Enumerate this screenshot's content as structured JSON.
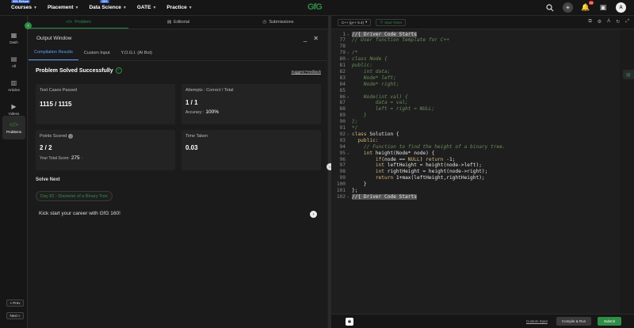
{
  "nav": {
    "items": [
      {
        "label": "Courses",
        "tag": "90% Refund"
      },
      {
        "label": "Placement",
        "tag": ""
      },
      {
        "label": "Data Science",
        "tag": "DSS"
      },
      {
        "label": "GATE",
        "tag": ""
      },
      {
        "label": "Practice",
        "tag": ""
      }
    ],
    "logo": "GfG",
    "notifications": "24",
    "avatar": "A"
  },
  "sidebar": {
    "items": [
      {
        "label": "Dash",
        "icon": "dash-icon"
      },
      {
        "label": "All",
        "icon": "all-icon"
      },
      {
        "label": "Articles",
        "icon": "articles-icon"
      },
      {
        "label": "Videos",
        "icon": "videos-icon"
      },
      {
        "label": "Problems",
        "icon": "code-icon"
      }
    ],
    "prev": "« Prev",
    "next": "Next »"
  },
  "problem_tabs": [
    {
      "label": "Problem",
      "active": true
    },
    {
      "label": "Editorial",
      "active": false
    },
    {
      "label": "Submissions",
      "active": false
    }
  ],
  "output": {
    "title": "Output Window",
    "tabs": [
      "Compilation Results",
      "Custom Input",
      "Y.O.G.I. (AI Bot)"
    ],
    "status": "Problem Solved Successfully",
    "feedback": "Suggest Feedback",
    "test_cases_label": "Test Cases Passed",
    "test_cases_value": "1115 / 1115",
    "attempts_label": "Attempts : Correct / Total",
    "attempts_value": "1 / 1",
    "accuracy_label": "Accuracy :",
    "accuracy_value": "100%",
    "points_label": "Points Scored",
    "points_value": "2 / 2",
    "total_score_label": "Your Total Score:",
    "total_score_value": "275",
    "time_label": "Time Taken",
    "time_value": "0.03",
    "solve_next": "Solve Next",
    "next_problem": "Day 82 - Diameter of a Binary Tree",
    "kick": "Kick start your career with GfG 160!"
  },
  "editor": {
    "language": "C++ (g++ 5.4)",
    "timer": "Start Timer",
    "lines": [
      {
        "n": "1",
        "html": "<span class=\"hl\">//{ Driver Code Starts</span>"
      },
      {
        "n": "77",
        "html": "<span class=\"cm\">// User function template for C++</span>"
      },
      {
        "n": "78",
        "html": ""
      },
      {
        "n": "79",
        "html": "<span class=\"cm\">/*</span>"
      },
      {
        "n": "80",
        "html": "<span class=\"cm\">class Node {</span>"
      },
      {
        "n": "81",
        "html": "<span class=\"cm\">public:</span>"
      },
      {
        "n": "82",
        "html": "<span class=\"cm\">    int data;</span>"
      },
      {
        "n": "83",
        "html": "<span class=\"cm\">    Node* left;</span>"
      },
      {
        "n": "84",
        "html": "<span class=\"cm\">    Node* right;</span>"
      },
      {
        "n": "85",
        "html": ""
      },
      {
        "n": "86",
        "html": "<span class=\"cm\">    Node(int val) {</span>"
      },
      {
        "n": "87",
        "html": "<span class=\"cm\">        data = val;</span>"
      },
      {
        "n": "88",
        "html": "<span class=\"cm\">        left = right = NULL;</span>"
      },
      {
        "n": "89",
        "html": "<span class=\"cm\">    }</span>"
      },
      {
        "n": "90",
        "html": "<span class=\"cm\">};</span>"
      },
      {
        "n": "91",
        "html": "<span class=\"cm\">*/</span>"
      },
      {
        "n": "92",
        "html": "<span class=\"kw\">class</span> Solution {"
      },
      {
        "n": "93",
        "html": "  <span class=\"kw\">public:</span>"
      },
      {
        "n": "94",
        "html": "    <span class=\"cm\">// Function to find the height of a binary tree.</span>"
      },
      {
        "n": "95",
        "html": "    <span class=\"kw\">int</span> height(Node* node) {"
      },
      {
        "n": "96",
        "html": "        <span class=\"kw\">if</span>(node == <span class=\"kw\">NULL</span>) <span class=\"kw\">return</span> -1;"
      },
      {
        "n": "97",
        "html": "        <span class=\"kw\">int</span> leftHeight = height(node->left);"
      },
      {
        "n": "98",
        "html": "        <span class=\"kw\">int</span> rightHeight = height(node->right);"
      },
      {
        "n": "99",
        "html": "        <span class=\"kw\">return</span> 1+max(leftHeight,rightHeight);"
      },
      {
        "n": "100",
        "html": "    }"
      },
      {
        "n": "101",
        "html": "};"
      },
      {
        "n": "102",
        "html": "<span class=\"hl\">//{ Driver Code Starts</span>"
      }
    ],
    "custom_input": "Custom Input",
    "compile_run": "Compile & Run",
    "submit": "Submit"
  }
}
